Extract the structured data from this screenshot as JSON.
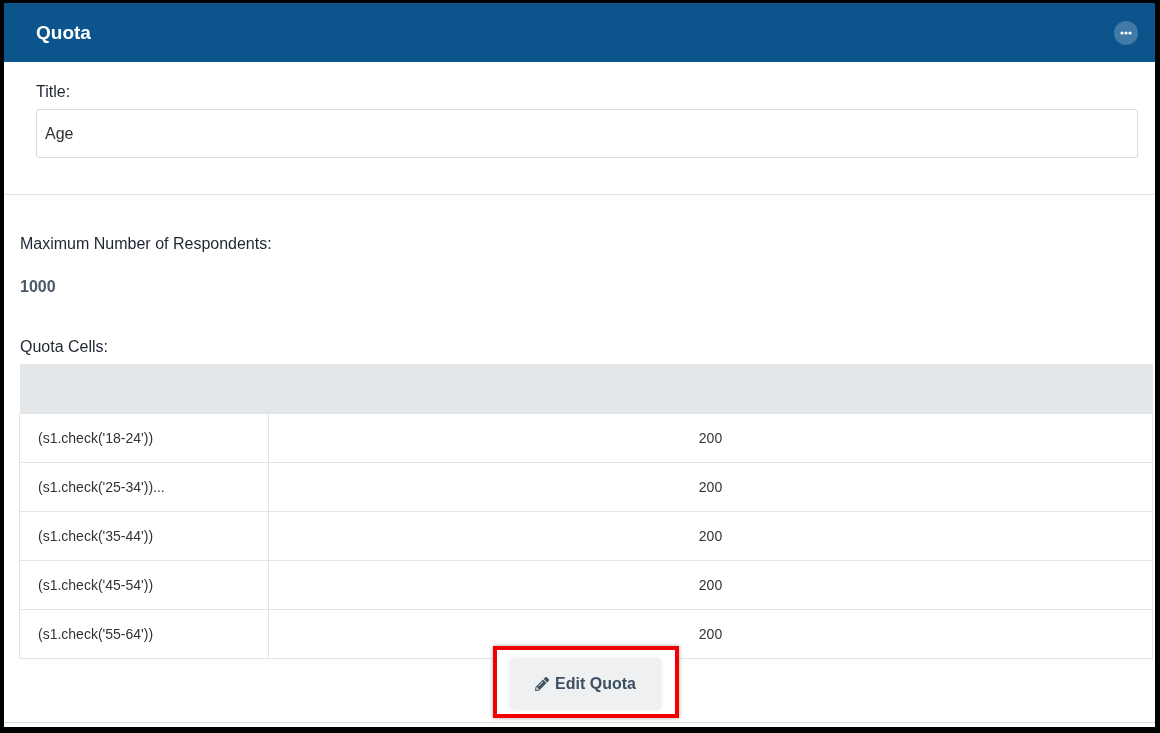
{
  "panel": {
    "title": "Quota"
  },
  "title_field": {
    "label": "Title:",
    "value": "Age"
  },
  "max_respondents": {
    "label": "Maximum Number of Respondents:",
    "value": "1000"
  },
  "quota_cells": {
    "label": "Quota Cells:",
    "rows": [
      {
        "condition": "(s1.check('18-24'))",
        "count": "200"
      },
      {
        "condition": "(s1.check('25-34'))...",
        "count": "200"
      },
      {
        "condition": "(s1.check('35-44'))",
        "count": "200"
      },
      {
        "condition": "(s1.check('45-54'))",
        "count": "200"
      },
      {
        "condition": "(s1.check('55-64'))",
        "count": "200"
      }
    ]
  },
  "edit_button": {
    "label": "Edit Quota",
    "highlighted": true
  }
}
